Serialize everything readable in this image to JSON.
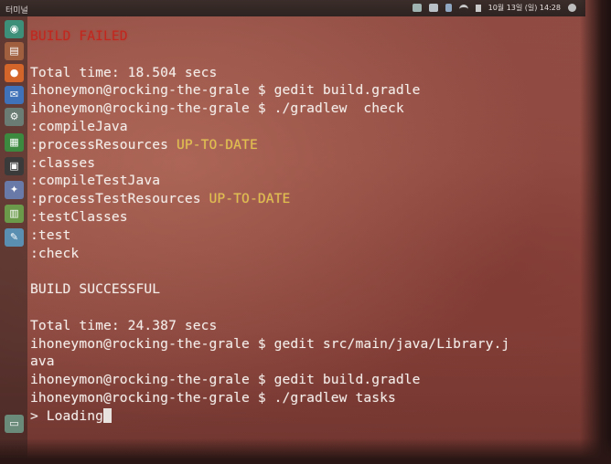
{
  "panel": {
    "title": "터미널",
    "datetime": "10월 13일 (일) 14:28",
    "icons": [
      "terminal-status-icon",
      "mail-icon",
      "bluetooth-icon",
      "wifi-icon",
      "volume-icon",
      "settings-gear-icon"
    ]
  },
  "launcher": {
    "items": [
      {
        "name": "dash-home-icon",
        "color": "#3d8f7a",
        "glyph": "◉"
      },
      {
        "name": "files-icon",
        "color": "#a06040",
        "glyph": "▤"
      },
      {
        "name": "firefox-icon",
        "color": "#d3642a",
        "glyph": "●"
      },
      {
        "name": "thunderbird-icon",
        "color": "#3f72b8",
        "glyph": "✉"
      },
      {
        "name": "settings-icon",
        "color": "#6b7c74",
        "glyph": "⚙"
      },
      {
        "name": "libreoffice-calc-icon",
        "color": "#3b8a3f",
        "glyph": "▦"
      },
      {
        "name": "terminal-icon",
        "color": "#3a3a3a",
        "glyph": "▣"
      },
      {
        "name": "system-monitor-icon",
        "color": "#6a7aa8",
        "glyph": "✦"
      },
      {
        "name": "text-editor-icon",
        "color": "#6a9a4a",
        "glyph": "▥"
      },
      {
        "name": "writer-icon",
        "color": "#5b8fb2",
        "glyph": "✎"
      },
      {
        "name": "trash-icon",
        "color": "#6a8a7a",
        "glyph": "▭"
      }
    ]
  },
  "terminal": {
    "lines": [
      {
        "text": "BUILD FAILED",
        "type": "fail"
      },
      {
        "text": "",
        "type": "plain"
      },
      {
        "text": "Total time: 18.504 secs",
        "type": "plain"
      },
      {
        "text": "ihoneymon@rocking-the-grale $ gedit build.gradle",
        "type": "plain"
      },
      {
        "text": "ihoneymon@rocking-the-grale $ ./gradlew  check",
        "type": "plain"
      },
      {
        "text": ":compileJava",
        "type": "plain"
      },
      {
        "text": ":processResources",
        "status": "UP-TO-DATE",
        "type": "status"
      },
      {
        "text": ":classes",
        "type": "plain"
      },
      {
        "text": ":compileTestJava",
        "type": "plain"
      },
      {
        "text": ":processTestResources",
        "status": "UP-TO-DATE",
        "type": "status"
      },
      {
        "text": ":testClasses",
        "type": "plain"
      },
      {
        "text": ":test",
        "type": "plain"
      },
      {
        "text": ":check",
        "type": "plain"
      },
      {
        "text": "",
        "type": "plain"
      },
      {
        "text": "BUILD SUCCESSFUL",
        "type": "plain"
      },
      {
        "text": "",
        "type": "plain"
      },
      {
        "text": "Total time: 24.387 secs",
        "type": "plain"
      },
      {
        "text": "ihoneymon@rocking-the-grale $ gedit src/main/java/Library.j",
        "type": "plain"
      },
      {
        "text": "ava",
        "type": "plain"
      },
      {
        "text": "ihoneymon@rocking-the-grale $ gedit build.gradle",
        "type": "plain"
      },
      {
        "text": "ihoneymon@rocking-the-grale $ ./gradlew tasks",
        "type": "plain"
      }
    ],
    "prompt_line": "> Loading"
  }
}
